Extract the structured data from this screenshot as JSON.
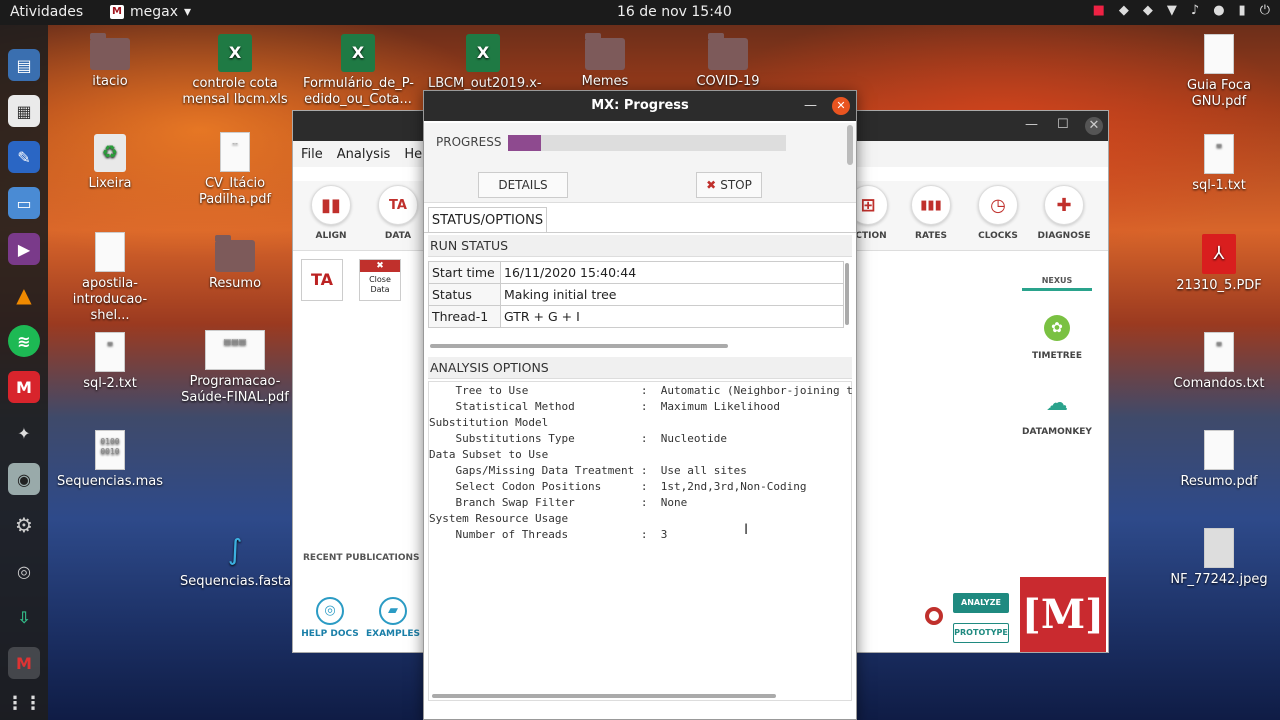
{
  "topbar": {
    "activities": "Atividades",
    "app_name": "megax",
    "app_arrow": "▾",
    "clock": "16 de nov  15:40"
  },
  "desktop": {
    "icons": [
      {
        "label": "itacio",
        "type": "folder-home-icon"
      },
      {
        "label": "controle cota mensal lbcm.xls",
        "type": "spreadsheet-icon"
      },
      {
        "label": "Formulário_de_P-edido_ou_Cota...",
        "type": "spreadsheet-icon"
      },
      {
        "label": "LBCM_out2019.x-",
        "type": "spreadsheet-icon"
      },
      {
        "label": "Memes",
        "type": "folder-icon"
      },
      {
        "label": "COVID-19",
        "type": "folder-icon"
      },
      {
        "label": "Guia Foca GNU.pdf",
        "type": "document-icon"
      },
      {
        "label": "Lixeira",
        "type": "trash-icon"
      },
      {
        "label": "CV_Itácio Padilha.pdf",
        "type": "document-icon"
      },
      {
        "label": "sql-1.txt",
        "type": "text-file-icon"
      },
      {
        "label": "apostila-introducao-shel...",
        "type": "document-icon"
      },
      {
        "label": "Resumo",
        "type": "folder-icon"
      },
      {
        "label": "21310_5.PDF",
        "type": "pdf-icon"
      },
      {
        "label": "sql-2.txt",
        "type": "text-file-icon"
      },
      {
        "label": "Programacao-Saúde-FINAL.pdf",
        "type": "document-icon"
      },
      {
        "label": "Comandos.txt",
        "type": "text-file-icon"
      },
      {
        "label": "Sequencias.mas",
        "type": "binary-file-icon"
      },
      {
        "label": "Resumo.pdf",
        "type": "document-icon"
      },
      {
        "label": "Sequencias.fasta",
        "type": "dna-file-icon"
      },
      {
        "label": "NF_77242.jpeg",
        "type": "image-file-icon"
      }
    ]
  },
  "mega": {
    "menu": [
      "File",
      "Analysis",
      "He"
    ],
    "toolbar": [
      {
        "label": "ALIGN",
        "glyph": "▮▮"
      },
      {
        "label": "DATA",
        "glyph": "TA"
      },
      {
        "label": "ECTION",
        "glyph": "⊞"
      },
      {
        "label": "RATES",
        "glyph": "▮▮▮"
      },
      {
        "label": "CLOCKS",
        "glyph": "◷"
      },
      {
        "label": "DIAGNOSE",
        "glyph": "✚"
      }
    ],
    "ta_card": "TA",
    "close_data": {
      "x": "✖",
      "line1": "Close",
      "line2": "Data"
    },
    "recent_publications": "RECENT PUBLICATIONS",
    "help_docs": "HELP DOCS",
    "examples": "EXAMPLES",
    "nexus": "NEXUS",
    "timetree": "TIMETREE",
    "datamonkey": "DATAMONKEY",
    "analyze": "ANALYZE",
    "prototype": "PROTOTYPE",
    "logo": "[M]"
  },
  "dialog": {
    "title": "MX: Progress",
    "progress_label": "PROGRESS",
    "progress_fraction": 0.12,
    "progress_color": "#8e4a8f",
    "details_button": "DETAILS",
    "stop_button": "STOP",
    "tab": "STATUS/OPTIONS",
    "run_status_title": "RUN STATUS",
    "run_status": [
      {
        "key": "Start time",
        "value": "16/11/2020 15:40:44"
      },
      {
        "key": "Status",
        "value": "Making initial tree"
      },
      {
        "key": "Thread-1",
        "value": "GTR + G + I"
      }
    ],
    "analysis_options_title": "ANALYSIS OPTIONS",
    "analysis_options_text": "    Tree to Use                 :  Automatic (Neighbor-joining tree)\n    Statistical Method          :  Maximum Likelihood\nSubstitution Model\n    Substitutions Type          :  Nucleotide\nData Subset to Use\n    Gaps/Missing Data Treatment :  Use all sites\n    Select Codon Positions      :  1st,2nd,3rd,Non-Coding\n    Branch Swap Filter          :  None\nSystem Resource Usage\n    Number of Threads           :  3"
  },
  "colors": {
    "accent_red": "#c0302c",
    "teal": "#1f8a80",
    "title_bar": "#2c2c2c"
  }
}
